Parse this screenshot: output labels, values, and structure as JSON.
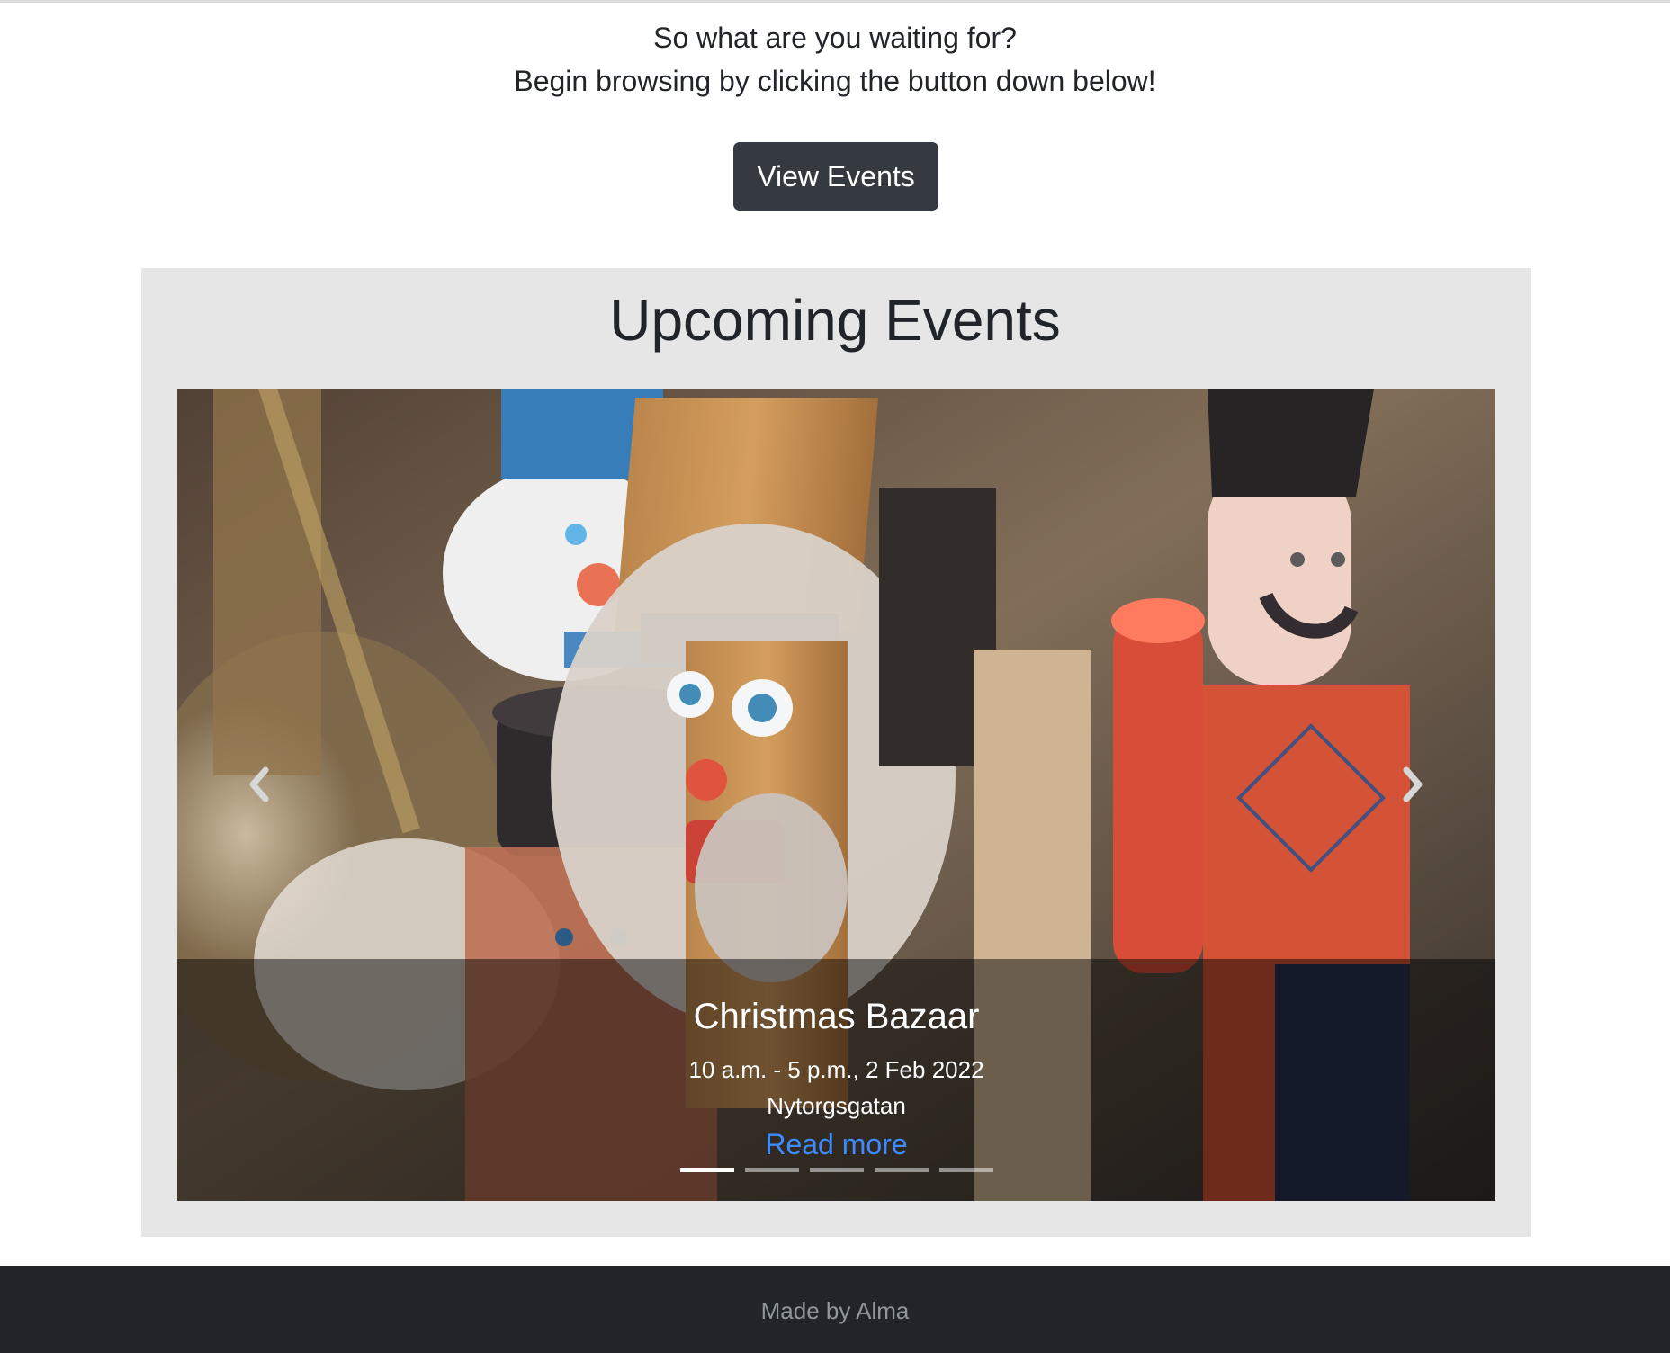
{
  "intro": {
    "line1": "So what are you waiting for?",
    "line2": "Begin browsing by clicking the button down below!"
  },
  "cta": {
    "label": "View Events"
  },
  "events": {
    "title": "Upcoming Events",
    "carousel": {
      "slide_title": "Christmas Bazaar",
      "slide_time": "10 a.m. - 5 p.m., 2 Feb 2022",
      "slide_location": "Nytorgsgatan",
      "read_more_label": "Read more",
      "prev_icon": "chevron-left-icon",
      "next_icon": "chevron-right-icon",
      "indicator_count": 5,
      "active_indicator": 1
    }
  },
  "footer": {
    "text": "Made by Alma"
  },
  "colors": {
    "button_bg": "#343a40",
    "panel_bg": "#e6e6e6",
    "footer_bg": "#212529",
    "link": "#3d8bfd"
  }
}
